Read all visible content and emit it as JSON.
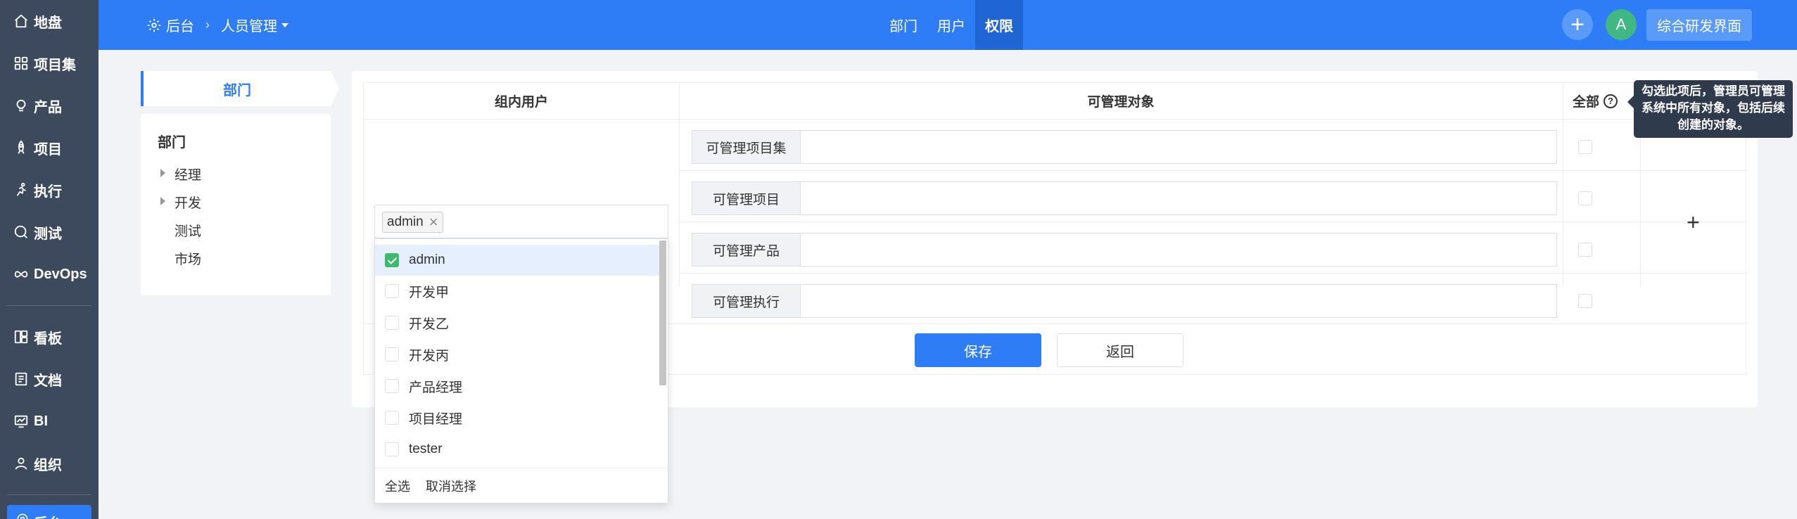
{
  "sidebar": {
    "items": [
      {
        "label": "地盘",
        "icon": "home-icon"
      },
      {
        "label": "项目集",
        "icon": "grid-icon"
      },
      {
        "label": "产品",
        "icon": "bulb-icon"
      },
      {
        "label": "项目",
        "icon": "rocket-icon"
      },
      {
        "label": "执行",
        "icon": "run-icon"
      },
      {
        "label": "测试",
        "icon": "test-icon"
      },
      {
        "label": "DevOps",
        "icon": "infinity-icon"
      },
      {
        "label": "看板",
        "icon": "kanban-icon"
      },
      {
        "label": "文档",
        "icon": "doc-icon"
      },
      {
        "label": "BI",
        "icon": "monitor-icon"
      },
      {
        "label": "组织",
        "icon": "people-icon"
      }
    ],
    "active_label": "后台"
  },
  "header": {
    "breadcrumb_home": "后台",
    "breadcrumb_current": "人员管理",
    "tabs": [
      "部门",
      "用户",
      "权限"
    ],
    "active_tab": "权限",
    "avatar_letter": "A",
    "switch_label": "综合研发界面"
  },
  "dept": {
    "tab_label": "部门",
    "title": "部门",
    "items": [
      {
        "label": "经理",
        "expandable": true
      },
      {
        "label": "开发",
        "expandable": true
      },
      {
        "label": "测试",
        "expandable": false
      },
      {
        "label": "市场",
        "expandable": false
      }
    ]
  },
  "table": {
    "col_users": "组内用户",
    "col_objects": "可管理对象",
    "col_all": "全部",
    "rows": [
      "可管理项目集",
      "可管理项目",
      "可管理产品",
      "可管理执行"
    ],
    "add_symbol": "+"
  },
  "user_select": {
    "tag": "admin",
    "options": [
      {
        "label": "admin",
        "checked": true
      },
      {
        "label": "开发甲",
        "checked": false
      },
      {
        "label": "开发乙",
        "checked": false
      },
      {
        "label": "开发丙",
        "checked": false
      },
      {
        "label": "产品经理",
        "checked": false
      },
      {
        "label": "项目经理",
        "checked": false
      },
      {
        "label": "tester",
        "checked": false
      }
    ],
    "select_all": "全选",
    "deselect": "取消选择"
  },
  "buttons": {
    "save": "保存",
    "back": "返回"
  },
  "tooltip": {
    "text": "勾选此项后，管理员可管理系统中所有对象，包括后续创建的对象。"
  },
  "colors": {
    "primary": "#2e7cf6",
    "sidebar": "#3d4a5e",
    "check": "#3fb96b"
  }
}
